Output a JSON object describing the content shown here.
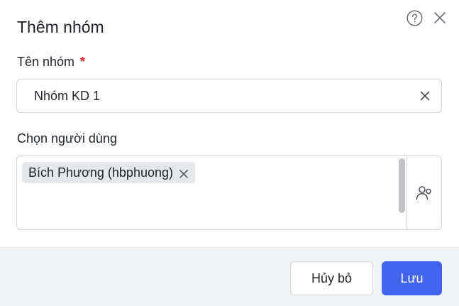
{
  "dialog": {
    "title": "Thêm nhóm"
  },
  "group_name": {
    "label": "Tên nhóm",
    "required_mark": "*",
    "value": "Nhóm KD 1"
  },
  "users": {
    "label": "Chọn người dùng",
    "selected": [
      {
        "label": "Bích Phương (hbphuong)"
      }
    ]
  },
  "footer": {
    "cancel_label": "Hủy bỏ",
    "save_label": "Lưu"
  },
  "colors": {
    "accent": "#4264f0",
    "required": "#e5252a",
    "footer_bg": "#f3f4f6",
    "tag_bg": "#e5e7eb"
  },
  "icons": {
    "help": "help-circle-icon",
    "close": "close-icon",
    "clear": "clear-icon",
    "tag_remove": "remove-tag-icon",
    "pick_users": "users-icon"
  }
}
